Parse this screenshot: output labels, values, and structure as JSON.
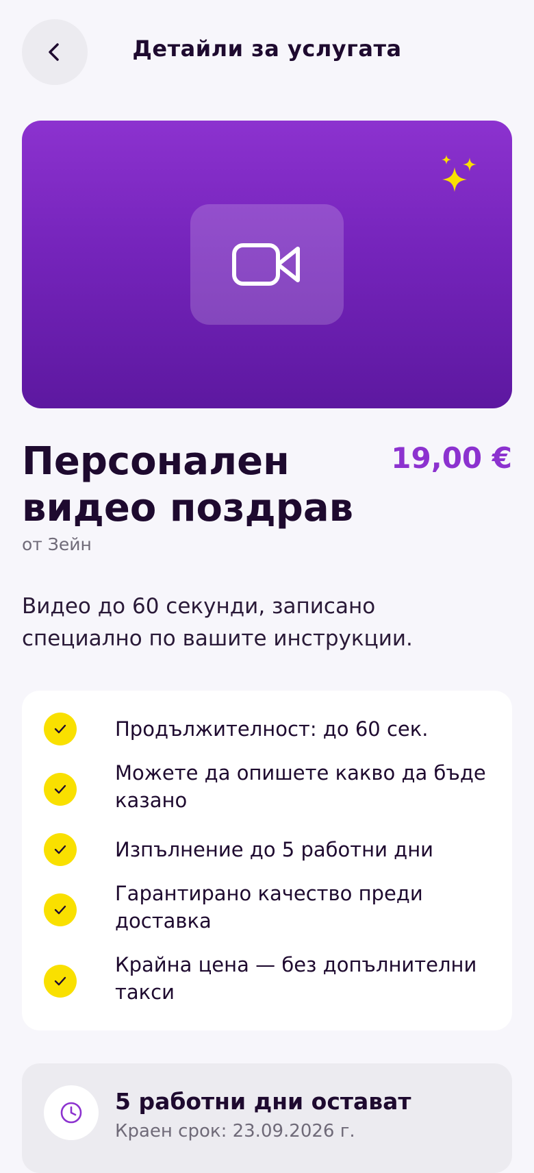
{
  "header": {
    "title": "Детайли за услугата",
    "back_icon": "chevron-left-icon"
  },
  "hero": {
    "icon": "video-camera-icon",
    "decor_icon": "sparkles-icon",
    "accent": "#8c32cf",
    "sparkle_color": "#f9e000"
  },
  "service": {
    "title": "Персонален видео поздрав",
    "price": "19,00 €",
    "author": "от Зейн",
    "description": "Видео до 60 секунди, записано специално по вашите инструкции."
  },
  "features": [
    {
      "text": "Продължителност: до 60 сек."
    },
    {
      "text": "Можете да опишете какво да бъде казано"
    },
    {
      "text": "Изпълнение до 5 работни дни"
    },
    {
      "text": "Гарантирано качество преди доставка"
    },
    {
      "text": "Крайна цена — без допълнителни такси"
    }
  ],
  "deadline": {
    "title": "5 работни дни остават",
    "subtitle": "Краен срок: 23.09.2026 г.",
    "icon": "clock-icon"
  }
}
